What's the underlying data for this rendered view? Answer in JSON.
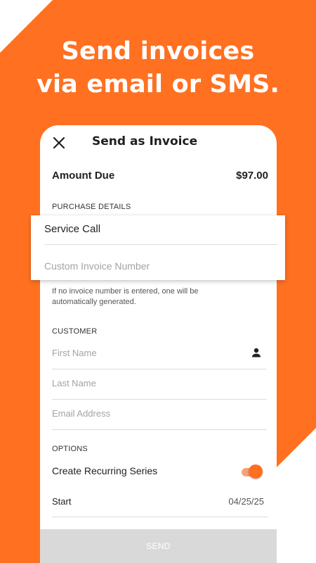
{
  "headline": {
    "line1": "Send invoices",
    "line2": "via email or SMS."
  },
  "colors": {
    "brand": "#ff7021",
    "toggle_on": "#ff6f21",
    "button_disabled": "#d9d9d9"
  },
  "header": {
    "close_icon": "close-icon",
    "title": "Send as Invoice"
  },
  "amount": {
    "label": "Amount Due",
    "value": "$97.00"
  },
  "purchase": {
    "section_label": "PURCHASE DETAILS",
    "service_value": "Service Call",
    "invoice_placeholder": "Custom Invoice Number",
    "helper": "If no invoice number is entered, one will be automatically generated."
  },
  "customer": {
    "section_label": "CUSTOMER",
    "first_name_placeholder": "First Name",
    "last_name_placeholder": "Last Name",
    "email_placeholder": "Email Address",
    "contact_icon": "person-icon"
  },
  "options": {
    "section_label": "OPTIONS",
    "recurring_label": "Create Recurring Series",
    "recurring_enabled": true,
    "start_label": "Start",
    "start_value": "04/25/25"
  },
  "send_button": {
    "label": "SEND"
  }
}
